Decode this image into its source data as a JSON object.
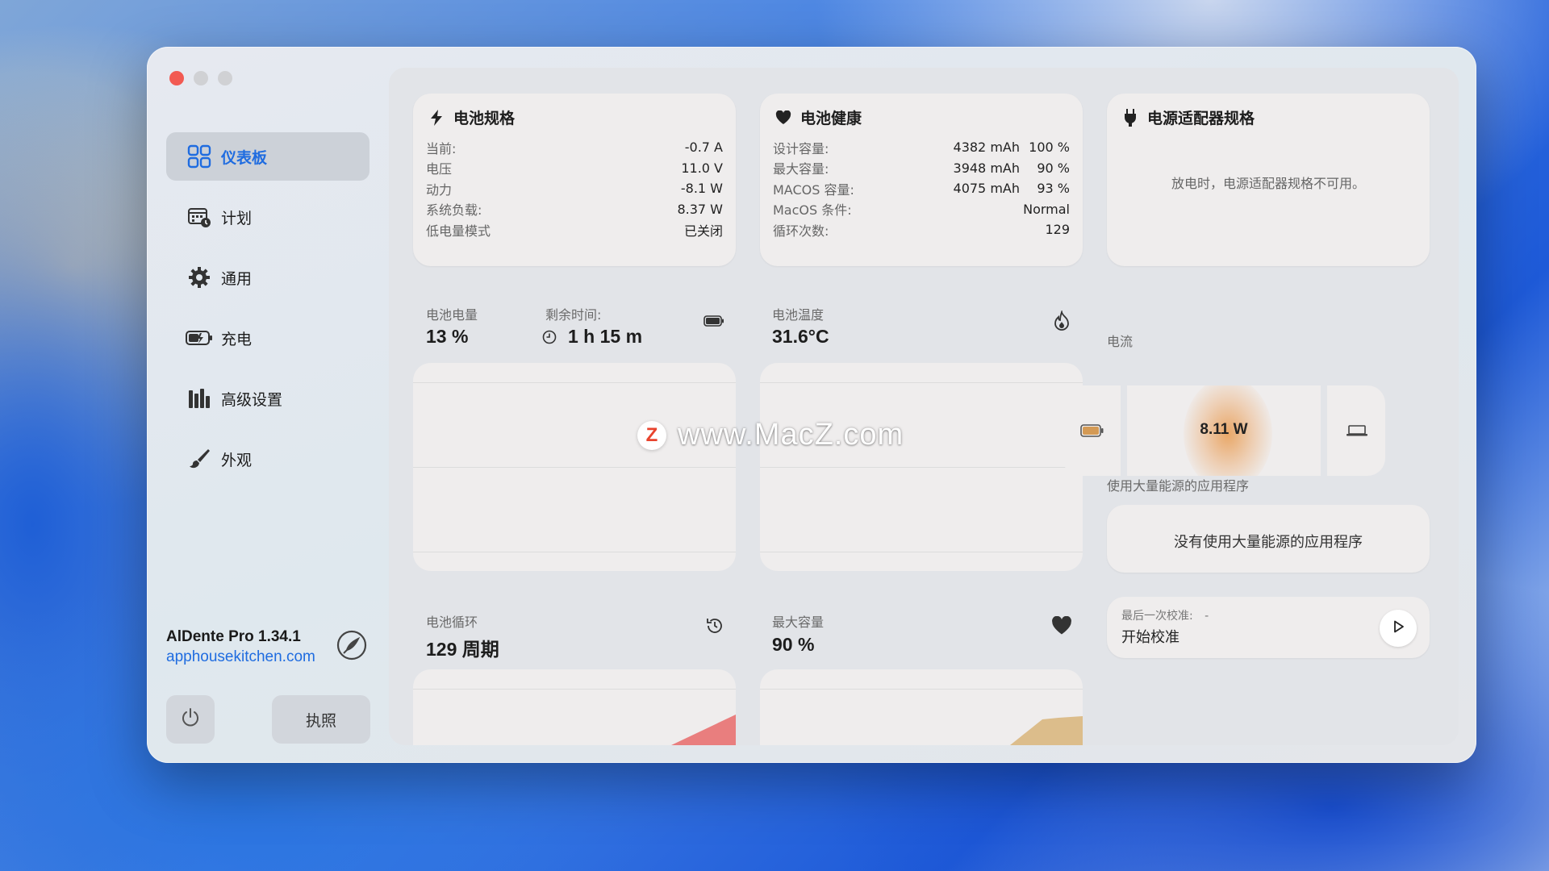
{
  "window": {
    "controls": [
      "close",
      "minimize",
      "maximize"
    ]
  },
  "sidebar": {
    "items": [
      {
        "label": "仪表板",
        "icon": "dashboard-icon",
        "active": true
      },
      {
        "label": "计划",
        "icon": "schedule-icon",
        "active": false
      },
      {
        "label": "通用",
        "icon": "gear-icon",
        "active": false
      },
      {
        "label": "充电",
        "icon": "charging-battery-icon",
        "active": false
      },
      {
        "label": "高级设置",
        "icon": "advanced-bars-icon",
        "active": false
      },
      {
        "label": "外观",
        "icon": "brush-icon",
        "active": false
      }
    ],
    "brand_name": "AlDente Pro 1.34.1",
    "brand_link": "apphousekitchen.com",
    "license_label": "执照"
  },
  "battery_specs": {
    "title": "电池规格",
    "rows": [
      {
        "key": "当前:",
        "value": "-0.7 A"
      },
      {
        "key": "电压",
        "value": "11.0 V"
      },
      {
        "key": "动力",
        "value": "-8.1 W"
      },
      {
        "key": "系统负载:",
        "value": "8.37 W"
      },
      {
        "key": "低电量模式",
        "value": "已关闭"
      }
    ]
  },
  "battery_health": {
    "title": "电池健康",
    "rows": [
      {
        "key": "设计容量:",
        "value": "4382 mAh",
        "value2": "100 %"
      },
      {
        "key": "最大容量:",
        "value": "3948 mAh",
        "value2": "90 %"
      },
      {
        "key": "MACOS 容量:",
        "value": "4075 mAh",
        "value2": "93 %"
      },
      {
        "key": "MacOS 条件:",
        "value": "Normal",
        "value2": ""
      },
      {
        "key": "循环次数:",
        "value": "129",
        "value2": ""
      }
    ]
  },
  "adapter": {
    "title": "电源适配器规格",
    "message": "放电时，电源适配器规格不可用。"
  },
  "stats": {
    "charge_label": "电池电量",
    "charge_value": "13 %",
    "remaining_label": "剩余时间:",
    "remaining_value": "1 h 15 m",
    "temp_label": "电池温度",
    "temp_value": "31.6°C",
    "current_label": "电流",
    "current_value": "8.11 W",
    "cycles_label": "电池循环",
    "cycles_value": "129 周期",
    "maxcap_label": "最大容量",
    "maxcap_value": "90 %"
  },
  "energy_apps": {
    "label": "使用大量能源的应用程序",
    "message": "没有使用大量能源的应用程序"
  },
  "calibration": {
    "last_label": "最后一次校准:",
    "last_value": "-",
    "start_label": "开始校准"
  },
  "watermark": {
    "logo": "Z",
    "text": "www.MacZ.com"
  },
  "colors": {
    "accent": "#1f6ce0",
    "close": "#f25a52",
    "cycles_area": "#e86a6a",
    "capacity_area": "#d9b77f"
  }
}
